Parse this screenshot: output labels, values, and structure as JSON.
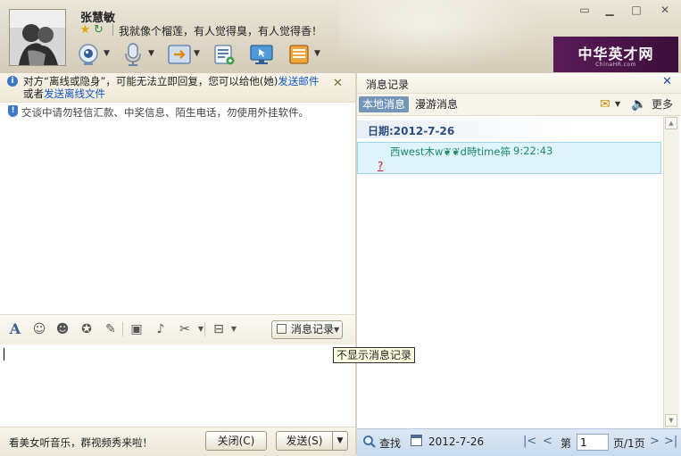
{
  "header": {
    "username": "张慧敏",
    "signature": "我就像个榴莲，有人觉得臭，有人觉得香！",
    "status_icons": [
      "star-icon",
      "refresh-icon"
    ],
    "toolbar_icons": [
      "camera-icon",
      "microphone-icon",
      "transfer-file-icon",
      "contact-list-icon",
      "remote-desktop-icon",
      "app-box-icon"
    ]
  },
  "ad": {
    "title": "中华英才网",
    "subtitle": "ChinaHR.com"
  },
  "window": {
    "controls": [
      "skin-icon",
      "minimize-icon",
      "maximize-icon",
      "close-icon"
    ]
  },
  "chat": {
    "offline_notice": {
      "prefix": "对方“离线或隐身”，可能无法立即回复，您可以给他(她)",
      "link1": "发送邮件",
      "middle": "或者",
      "link2": "发送离线文件"
    },
    "security_notice": "交谈中请勿轻信汇款、中奖信息、陌生电话，勿使用外挂软件。",
    "input_toolbar_icons": [
      "font-icon",
      "emoji-icon",
      "magic-emoji-icon",
      "shake-window-icon",
      "graffiti-icon",
      "image-icon",
      "music-icon",
      "screenshot-icon",
      "more-icon"
    ],
    "history_button": "消息记录",
    "tooltip": "不显示消息记录",
    "promo": "看美女听音乐，群视频秀来啦！",
    "close_button": "关闭(C)",
    "send_button": "发送(S)"
  },
  "history": {
    "title": "消息记录",
    "tabs": {
      "local": "本地消息",
      "roaming": "漫游消息"
    },
    "more": "更多",
    "date_label": "日期:2012-7-26",
    "messages": [
      {
        "sender": "西west木w❦❦d時time筗",
        "time": "9:22:43",
        "body": "?"
      }
    ],
    "footer": {
      "find": "查找",
      "date": "2012-7-26",
      "page_prefix": "第",
      "page_value": "1",
      "page_suffix": "页/1页"
    }
  },
  "colors": {
    "accent_blue": "#7395b8",
    "message_bg": "#def3fb",
    "sender_green": "#1c8a63",
    "message_red": "#c9151e",
    "link_blue": "#1357c4",
    "ad_purple": "#5a1c58"
  }
}
